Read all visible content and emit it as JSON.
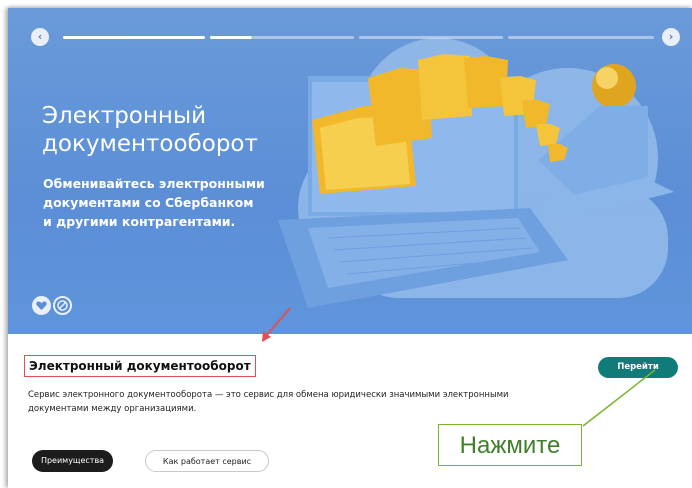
{
  "banner": {
    "title": "Электронный\nдокументооборот",
    "subtitle": "Обменивайтесь электронными\nдокументами со Сбербанком\nи другими контрагентами.",
    "prev_symbol": "‹",
    "next_symbol": "›",
    "background_color": "#5b8ed6"
  },
  "service": {
    "title": "Электронный документооборот",
    "go_button": "Перейти",
    "description": "Сервис электронного документооборота — это сервис для обмена юридически значимыми электронными документами между организациями.",
    "tabs": [
      {
        "label": "Преимущества",
        "active": true
      },
      {
        "label": "Как работает сервис",
        "active": false
      }
    ],
    "accent_color": "#117b79"
  },
  "annotation": {
    "callout_text": "Нажмите",
    "highlight_color": "#e05050",
    "callout_color": "#7ab32e"
  }
}
